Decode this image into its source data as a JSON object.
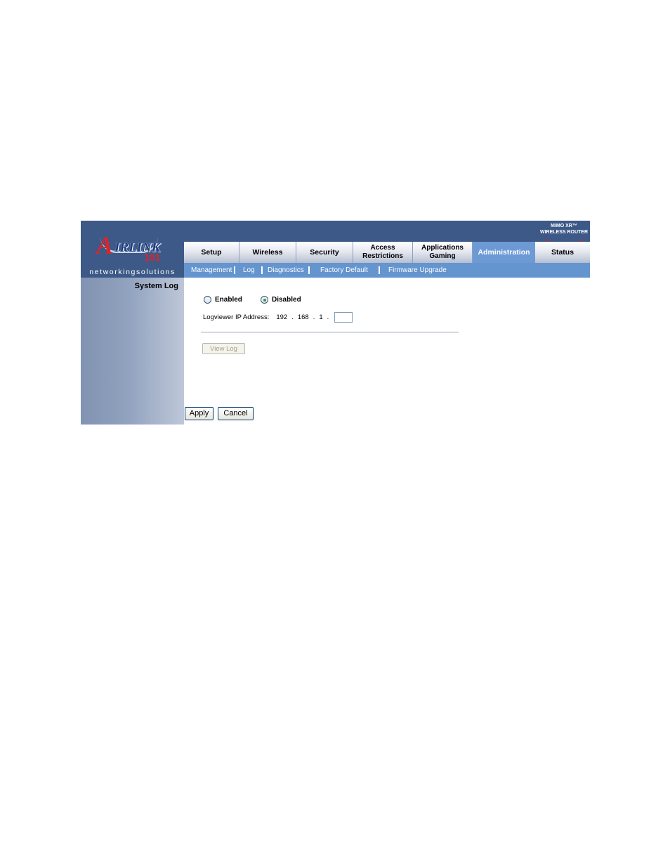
{
  "brand": {
    "logo_text": "AIRLINK 101",
    "tagline": "networkingsolutions",
    "product": "MIMO XR™ WIRELESS ROUTER"
  },
  "tabs": [
    {
      "label": "Setup",
      "active": false
    },
    {
      "label": "Wireless",
      "active": false
    },
    {
      "label": "Security",
      "active": false
    },
    {
      "label": "Access Restrictions",
      "line1": "Access",
      "line2": "Restrictions",
      "active": false
    },
    {
      "label": "Applications Gaming",
      "line1": "Applications",
      "line2": "Gaming",
      "active": false
    },
    {
      "label": "Administration",
      "active": true
    },
    {
      "label": "Status",
      "active": false
    }
  ],
  "subnav": [
    "Management",
    "Log",
    "Diagnostics",
    "Factory Default",
    "Firmware Upgrade"
  ],
  "sidebar": {
    "section_title": "System Log"
  },
  "log": {
    "enabled_label": "Enabled",
    "disabled_label": "Disabled",
    "selected": "Disabled",
    "ip_label": "Logviewer IP Address:",
    "ip_octets": [
      "192",
      "168",
      "1"
    ],
    "ip_dot": ".",
    "ip_last": "",
    "view_log_label": "View Log"
  },
  "buttons": {
    "apply": "Apply",
    "cancel": "Cancel"
  }
}
